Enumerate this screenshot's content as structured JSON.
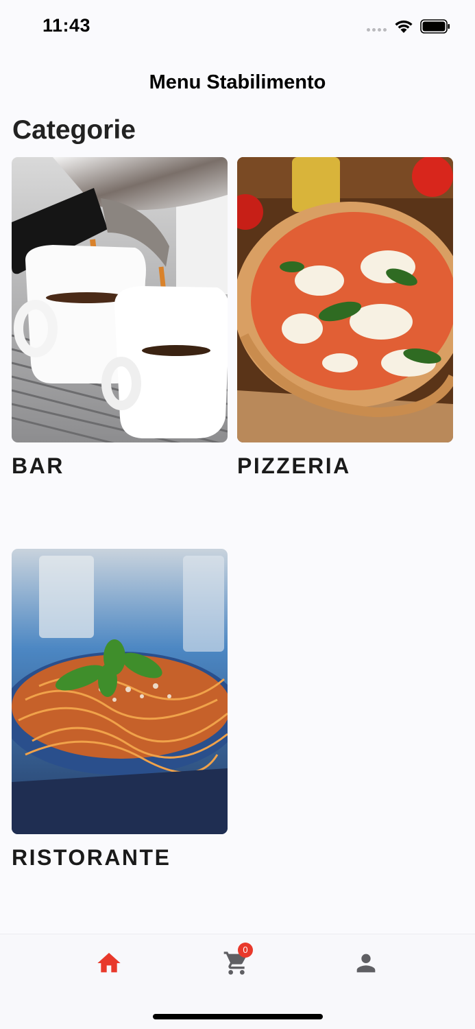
{
  "status_bar": {
    "time": "11:43"
  },
  "header": {
    "title": "Menu Stabilimento"
  },
  "section": {
    "title": "Categorie"
  },
  "categories": [
    {
      "label": "BAR",
      "image": "espresso-machine-photo"
    },
    {
      "label": "PIZZERIA",
      "image": "pizza-margherita-photo"
    },
    {
      "label": "RISTORANTE",
      "image": "spaghetti-bolognese-photo"
    }
  ],
  "tab_bar": {
    "items": [
      {
        "icon": "home-icon",
        "active": true
      },
      {
        "icon": "cart-icon",
        "badge": "0"
      },
      {
        "icon": "person-icon"
      }
    ]
  },
  "colors": {
    "accent": "#e8392b",
    "inactive_icon": "#5f5f63",
    "background": "#fafafd"
  }
}
